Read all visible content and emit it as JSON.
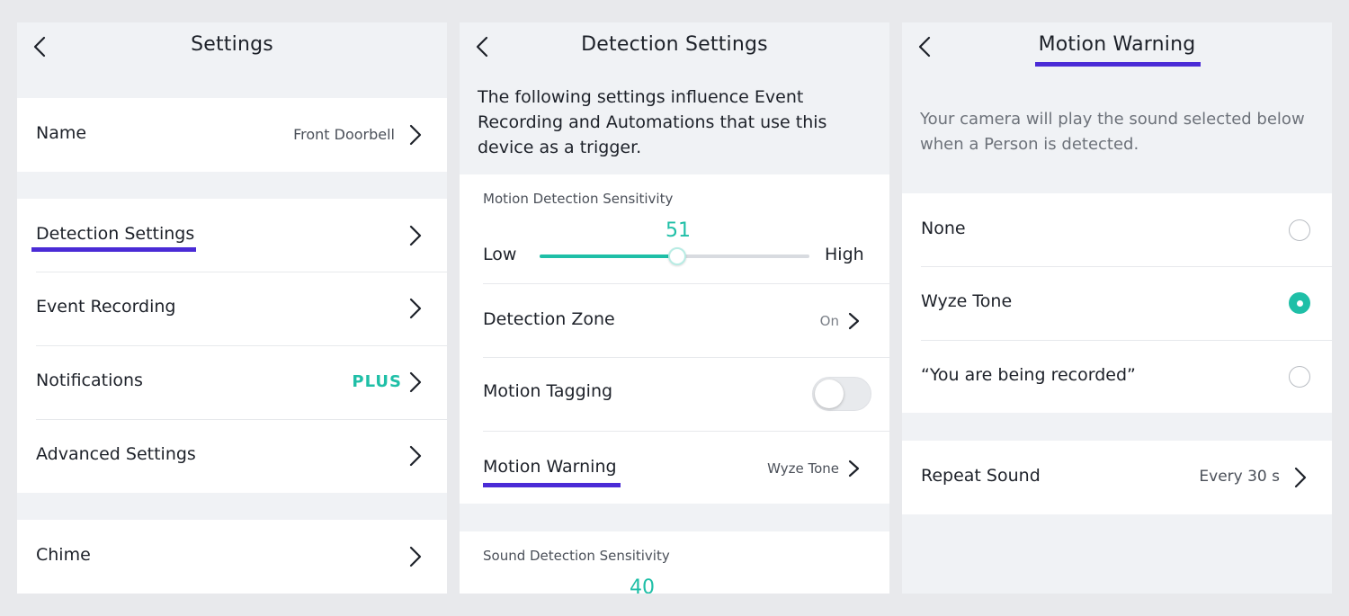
{
  "settings": {
    "title": "Settings",
    "name_label": "Name",
    "name_value": "Front Doorbell",
    "items": [
      {
        "label": "Detection Settings"
      },
      {
        "label": "Event Recording"
      },
      {
        "label": "Notifications",
        "badge": "PLUS"
      },
      {
        "label": "Advanced Settings"
      }
    ],
    "chime_label": "Chime"
  },
  "detection": {
    "title": "Detection Settings",
    "description": "The following settings influence Event Recording and Automations that use this device as a trigger.",
    "motion_sensitivity": {
      "label": "Motion Detection Sensitivity",
      "value": 51,
      "min": 0,
      "max": 100,
      "low_label": "Low",
      "high_label": "High"
    },
    "detection_zone": {
      "label": "Detection Zone",
      "value": "On"
    },
    "motion_tagging": {
      "label": "Motion Tagging",
      "enabled": false
    },
    "motion_warning": {
      "label": "Motion Warning",
      "value": "Wyze Tone"
    },
    "sound_sensitivity": {
      "label": "Sound Detection Sensitivity",
      "value": 40
    }
  },
  "warning": {
    "title": "Motion Warning",
    "description": "Your camera will play the sound selected below when a Person is detected.",
    "options": [
      {
        "label": "None",
        "selected": false
      },
      {
        "label": "Wyze Tone",
        "selected": true
      },
      {
        "label": "“You are being recorded”",
        "selected": false
      }
    ],
    "repeat_label": "Repeat Sound",
    "repeat_value": "Every 30 s"
  },
  "colors": {
    "accent": "#1fbfa7",
    "highlight_underline": "#4a2bd6"
  }
}
